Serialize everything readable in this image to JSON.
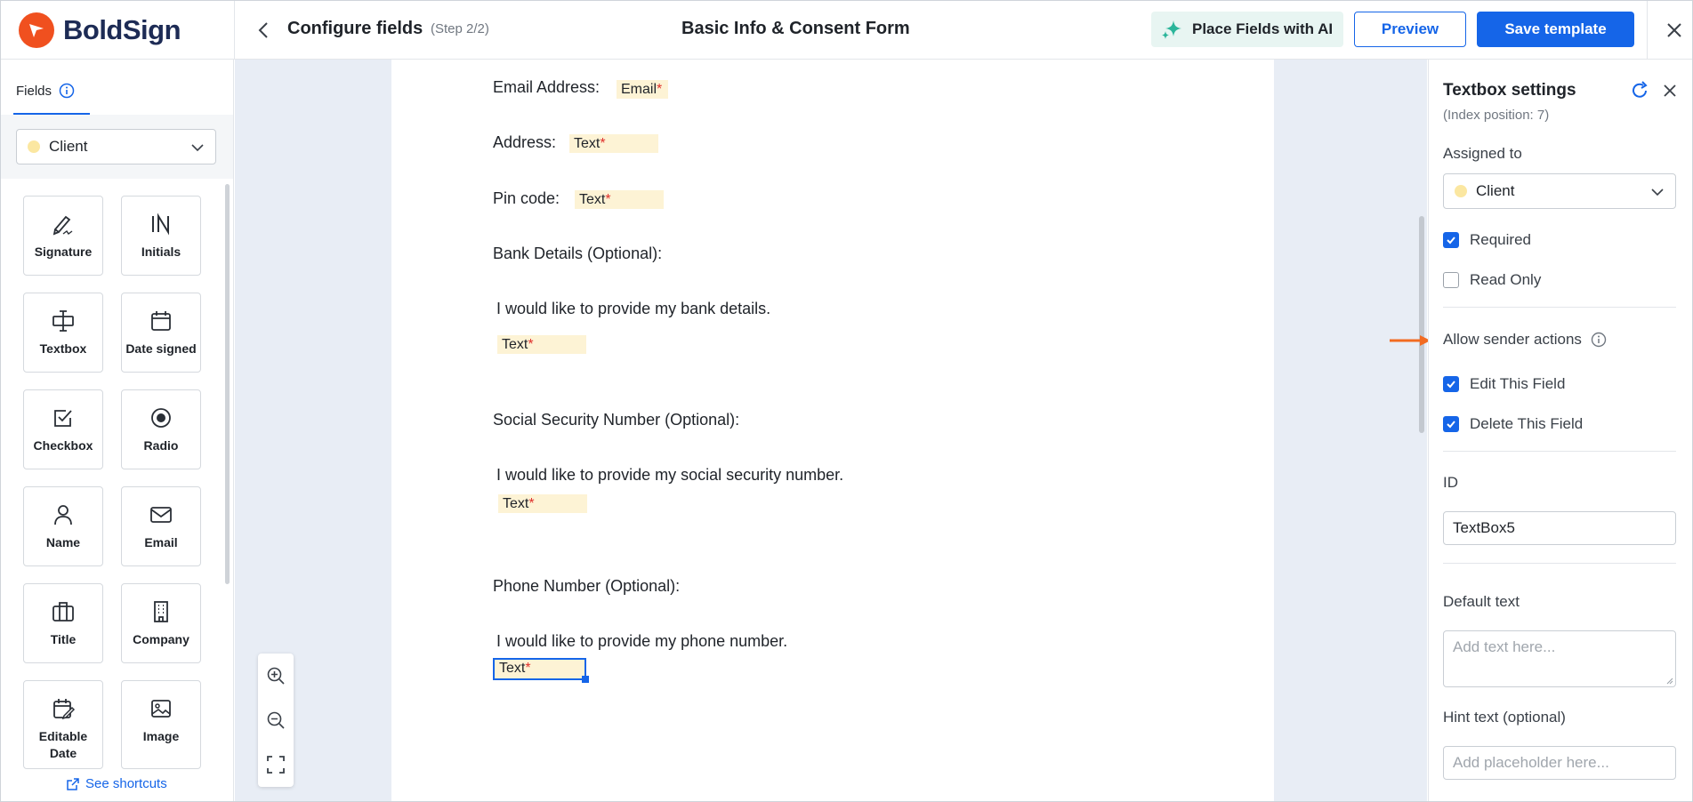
{
  "header": {
    "brand": "BoldSign",
    "page_title": "Configure fields",
    "step": "(Step 2/2)",
    "document_title": "Basic Info & Consent Form",
    "ai_button": "Place Fields with AI",
    "preview_button": "Preview",
    "save_button": "Save template"
  },
  "sidebar": {
    "tab_label": "Fields",
    "signer": "Client",
    "fields": [
      {
        "label": "Signature",
        "icon": "signature-icon"
      },
      {
        "label": "Initials",
        "icon": "initials-icon"
      },
      {
        "label": "Textbox",
        "icon": "textbox-icon"
      },
      {
        "label": "Date signed",
        "icon": "calendar-icon"
      },
      {
        "label": "Checkbox",
        "icon": "checkbox-icon"
      },
      {
        "label": "Radio",
        "icon": "radio-icon"
      },
      {
        "label": "Name",
        "icon": "person-icon"
      },
      {
        "label": "Email",
        "icon": "mail-icon"
      },
      {
        "label": "Title",
        "icon": "briefcase-icon"
      },
      {
        "label": "Company",
        "icon": "building-icon"
      },
      {
        "label": "Editable Date",
        "icon": "editable-date-icon"
      },
      {
        "label": "Image",
        "icon": "image-icon"
      }
    ],
    "shortcuts_link": "See shortcuts"
  },
  "document": {
    "email_label": "Email Address:",
    "email_field": "Email",
    "address_label": "Address:",
    "address_field": "Text",
    "pin_label": "Pin code:",
    "pin_field": "Text",
    "bank_heading": "Bank Details (Optional):",
    "bank_text": "I would like to provide my bank details.",
    "bank_field": "Text",
    "ssn_heading": "Social Security Number (Optional):",
    "ssn_text": "I would like to provide my social security number.",
    "ssn_field": "Text",
    "phone_heading": "Phone Number (Optional):",
    "phone_text": "I would like to provide my phone number.",
    "phone_field": "Text",
    "required_mark": "*"
  },
  "panel": {
    "title": "Textbox settings",
    "subtitle": "(Index position: 7)",
    "assigned_label": "Assigned to",
    "assigned_value": "Client",
    "required_label": "Required",
    "required_checked": true,
    "readonly_label": "Read Only",
    "readonly_checked": false,
    "sender_actions_label": "Allow sender actions",
    "edit_label": "Edit This Field",
    "edit_checked": true,
    "delete_label": "Delete This Field",
    "delete_checked": true,
    "id_label": "ID",
    "id_value": "TextBox5",
    "default_text_label": "Default text",
    "default_text_placeholder": "Add text here...",
    "hint_label": "Hint text (optional)",
    "hint_placeholder": "Add placeholder here..."
  },
  "colors": {
    "brand_orange": "#f0501f",
    "primary_blue": "#1565e8",
    "field_fill": "#fdf3d5",
    "signer_dot": "#fbe7a1",
    "arrow": "#f26b21"
  }
}
